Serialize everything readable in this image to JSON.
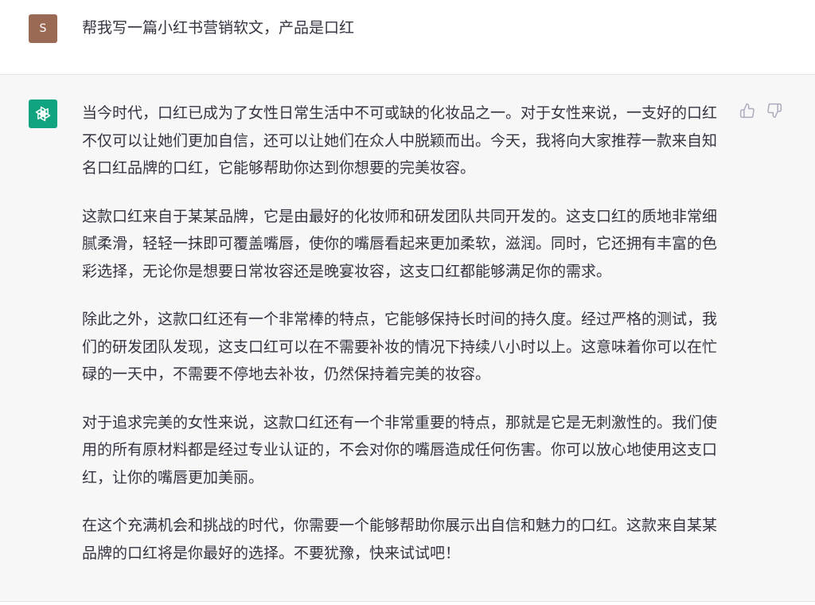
{
  "user": {
    "avatar_initial": "S",
    "message": "帮我写一篇小红书营销软文，产品是口红"
  },
  "assistant": {
    "paragraphs": [
      "当今时代，口红已成为了女性日常生活中不可或缺的化妆品之一。对于女性来说，一支好的口红不仅可以让她们更加自信，还可以让她们在众人中脱颖而出。今天，我将向大家推荐一款来自知名口红品牌的口红，它能够帮助你达到你想要的完美妆容。",
      "这款口红来自于某某品牌，它是由最好的化妆师和研发团队共同开发的。这支口红的质地非常细腻柔滑，轻轻一抹即可覆盖嘴唇，使你的嘴唇看起来更加柔软，滋润。同时，它还拥有丰富的色彩选择，无论你是想要日常妆容还是晚宴妆容，这支口红都能够满足你的需求。",
      "除此之外，这款口红还有一个非常棒的特点，它能够保持长时间的持久度。经过严格的测试，我们的研发团队发现，这支口红可以在不需要补妆的情况下持续八小时以上。这意味着你可以在忙碌的一天中，不需要不停地去补妆，仍然保持着完美的妆容。",
      "对于追求完美的女性来说，这款口红还有一个非常重要的特点，那就是它是无刺激性的。我们使用的所有原材料都是经过专业认证的，不会对你的嘴唇造成任何伤害。你可以放心地使用这支口红，让你的嘴唇更加美丽。",
      "在这个充满机会和挑战的时代，你需要一个能够帮助你展示出自信和魅力的口红。这款来自某某品牌的口红将是你最好的选择。不要犹豫，快来试试吧！"
    ]
  },
  "icons": {
    "assistant_avatar": "openai-logo-icon",
    "thumb_up": "thumbs-up-icon",
    "thumb_down": "thumbs-down-icon"
  },
  "colors": {
    "user_avatar_bg": "#9a6a55",
    "assistant_avatar_bg": "#10a37f",
    "assistant_row_bg": "#f7f7f8",
    "text": "#343541",
    "icon": "#acacbe"
  }
}
